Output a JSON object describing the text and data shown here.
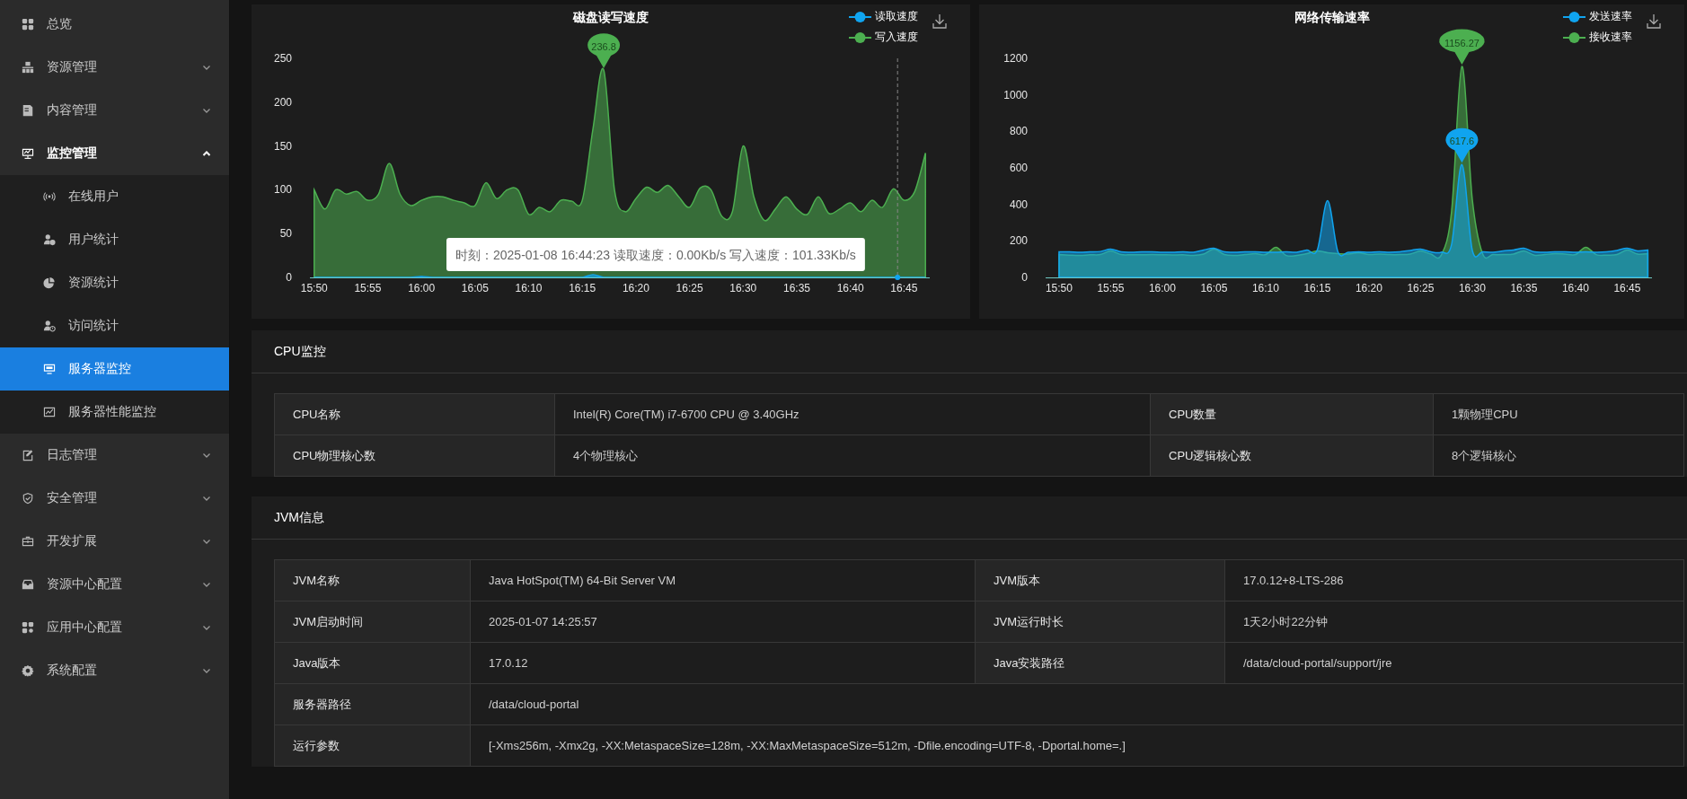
{
  "sidebar": {
    "items": [
      {
        "label": "总览",
        "kind": "link",
        "selected": false
      },
      {
        "label": "资源管理",
        "kind": "group",
        "selected": false,
        "expanded": false
      },
      {
        "label": "内容管理",
        "kind": "group",
        "selected": false,
        "expanded": false
      },
      {
        "label": "监控管理",
        "kind": "group",
        "selected": false,
        "expanded": true,
        "children": [
          {
            "label": "在线用户",
            "selected": false
          },
          {
            "label": "用户统计",
            "selected": false
          },
          {
            "label": "资源统计",
            "selected": false
          },
          {
            "label": "访问统计",
            "selected": false
          },
          {
            "label": "服务器监控",
            "selected": true
          },
          {
            "label": "服务器性能监控",
            "selected": false
          }
        ]
      },
      {
        "label": "日志管理",
        "kind": "group",
        "selected": false,
        "expanded": false
      },
      {
        "label": "安全管理",
        "kind": "group",
        "selected": false,
        "expanded": false
      },
      {
        "label": "开发扩展",
        "kind": "group",
        "selected": false,
        "expanded": false
      },
      {
        "label": "资源中心配置",
        "kind": "group",
        "selected": false,
        "expanded": false
      },
      {
        "label": "应用中心配置",
        "kind": "group",
        "selected": false,
        "expanded": false
      },
      {
        "label": "系统配置",
        "kind": "group",
        "selected": false,
        "expanded": false
      }
    ]
  },
  "charts": [
    {
      "chart_data": {
        "type": "area",
        "title": "磁盘读写速度",
        "categories": [
          "15:50",
          null,
          null,
          null,
          null,
          "15:55",
          null,
          null,
          null,
          null,
          "16:00",
          null,
          null,
          null,
          null,
          "16:05",
          null,
          null,
          null,
          null,
          "16:10",
          null,
          null,
          null,
          null,
          "16:15",
          null,
          null,
          null,
          null,
          "16:20",
          null,
          null,
          null,
          null,
          "16:25",
          null,
          null,
          null,
          null,
          "16:30",
          null,
          null,
          null,
          null,
          "16:35",
          null,
          null,
          null,
          null,
          "16:40",
          null,
          null,
          null,
          null,
          "16:45",
          null,
          null
        ],
        "series": [
          {
            "name": "读取速度",
            "color": "#10a4ef",
            "values": [
              0,
              0,
              0,
              0,
              0,
              0,
              0,
              0,
              0,
              0,
              1,
              0,
              0,
              0,
              0,
              0,
              0,
              0,
              0,
              0,
              0,
              0,
              0,
              0,
              0,
              0,
              3,
              0,
              0,
              0,
              0,
              0,
              0,
              0,
              0,
              0,
              0,
              0,
              0,
              0,
              0,
              0,
              0,
              0,
              0,
              0,
              0,
              0,
              0,
              0,
              0,
              0,
              0,
              0,
              0,
              0,
              0,
              0
            ]
          },
          {
            "name": "写入速度",
            "color": "#4caf50",
            "values": [
              100,
              78,
              100,
              95,
              98,
              88,
              95,
              130,
              95,
              82,
              88,
              92,
              92,
              88,
              85,
              82,
              108,
              90,
              100,
              100,
              72,
              80,
              75,
              88,
              87,
              88,
              170,
              236.8,
              100,
              75,
              90,
              103,
              97,
              105,
              92,
              80,
              102,
              100,
              70,
              75,
              150,
              92,
              65,
              78,
              92,
              78,
              72,
              92,
              73,
              78,
              85,
              75,
              88,
              80,
              101,
              88,
              98,
              142
            ]
          }
        ],
        "ylim": [
          0,
          250
        ],
        "yticks": [
          0,
          50,
          100,
          150,
          200,
          250
        ],
        "annotations": [
          {
            "y": 236.8,
            "text": "236.8"
          },
          "时刻：2025-01-08 16:44:23 读取速度：0.00Kb/s 写入速度：101.33Kb/s"
        ]
      }
    },
    {
      "chart_data": {
        "type": "area",
        "title": "网络传输速率",
        "categories": [
          "15:50",
          null,
          null,
          null,
          null,
          "15:55",
          null,
          null,
          null,
          null,
          "16:00",
          null,
          null,
          null,
          null,
          "16:05",
          null,
          null,
          null,
          null,
          "16:10",
          null,
          null,
          null,
          null,
          "16:15",
          null,
          null,
          null,
          null,
          "16:20",
          null,
          null,
          null,
          null,
          "16:25",
          null,
          null,
          null,
          null,
          "16:30",
          null,
          null,
          null,
          null,
          "16:35",
          null,
          null,
          null,
          null,
          "16:40",
          null,
          null,
          null,
          null,
          "16:45",
          null,
          null
        ],
        "series": [
          {
            "name": "发送速率",
            "color": "#10a4ef",
            "values": [
              140,
              140,
              138,
              140,
              142,
              155,
              140,
              138,
              140,
              140,
              138,
              138,
              140,
              138,
              150,
              160,
              140,
              138,
              140,
              140,
              138,
              138,
              140,
              138,
              150,
              150,
              420,
              140,
              138,
              140,
              138,
              140,
              138,
              140,
              148,
              155,
              140,
              138,
              180,
              618,
              150,
              140,
              138,
              145,
              150,
              160,
              140,
              138,
              140,
              140,
              138,
              140,
              138,
              140,
              148,
              160,
              145,
              150
            ]
          },
          {
            "name": "接收速率",
            "color": "#4caf50",
            "values": [
              125,
              122,
              120,
              124,
              125,
              145,
              125,
              124,
              124,
              125,
              124,
              123,
              124,
              120,
              128,
              155,
              125,
              120,
              125,
              130,
              125,
              165,
              120,
              120,
              130,
              145,
              135,
              130,
              128,
              135,
              125,
              128,
              125,
              125,
              128,
              145,
              128,
              122,
              360,
              1156,
              430,
              130,
              125,
              125,
              128,
              145,
              122,
              125,
              130,
              128,
              125,
              165,
              125,
              122,
              125,
              150,
              128,
              130
            ]
          }
        ],
        "ylim": [
          0,
          1200
        ],
        "yticks": [
          0,
          200,
          400,
          600,
          800,
          1000,
          1200
        ],
        "annotations": [
          {
            "y": 1156,
            "text": "1156.27"
          },
          {
            "y": 618,
            "text": "617.6"
          }
        ]
      }
    }
  ],
  "sections": [
    {
      "title": "CPU监控",
      "rows": [
        [
          {
            "label": "CPU名称",
            "value": "Intel(R) Core(TM) i7-6700 CPU @ 3.40GHz"
          },
          {
            "label": "CPU数量",
            "value": "1颗物理CPU"
          }
        ],
        [
          {
            "label": "CPU物理核心数",
            "value": "4个物理核心"
          },
          {
            "label": "CPU逻辑核心数",
            "value": "8个逻辑核心"
          }
        ]
      ]
    },
    {
      "title": "JVM信息",
      "rows": [
        [
          {
            "label": "JVM名称",
            "value": "Java HotSpot(TM) 64-Bit Server VM"
          },
          {
            "label": "JVM版本",
            "value": "17.0.12+8-LTS-286"
          }
        ],
        [
          {
            "label": "JVM启动时间",
            "value": "2025-01-07 14:25:57"
          },
          {
            "label": "JVM运行时长",
            "value": "1天2小时22分钟"
          }
        ],
        [
          {
            "label": "Java版本",
            "value": "17.0.12"
          },
          {
            "label": "Java安装路径",
            "value": "/data/cloud-portal/support/jre"
          }
        ],
        [
          {
            "label": "服务器路径",
            "value": "/data/cloud-portal"
          }
        ],
        [
          {
            "label": "运行参数",
            "value": "[-Xms256m, -Xmx2g, -XX:MetaspaceSize=128m, -XX:MaxMetaspaceSize=512m, -Dfile.encoding=UTF-8, -Dportal.home=.]"
          }
        ]
      ]
    }
  ]
}
